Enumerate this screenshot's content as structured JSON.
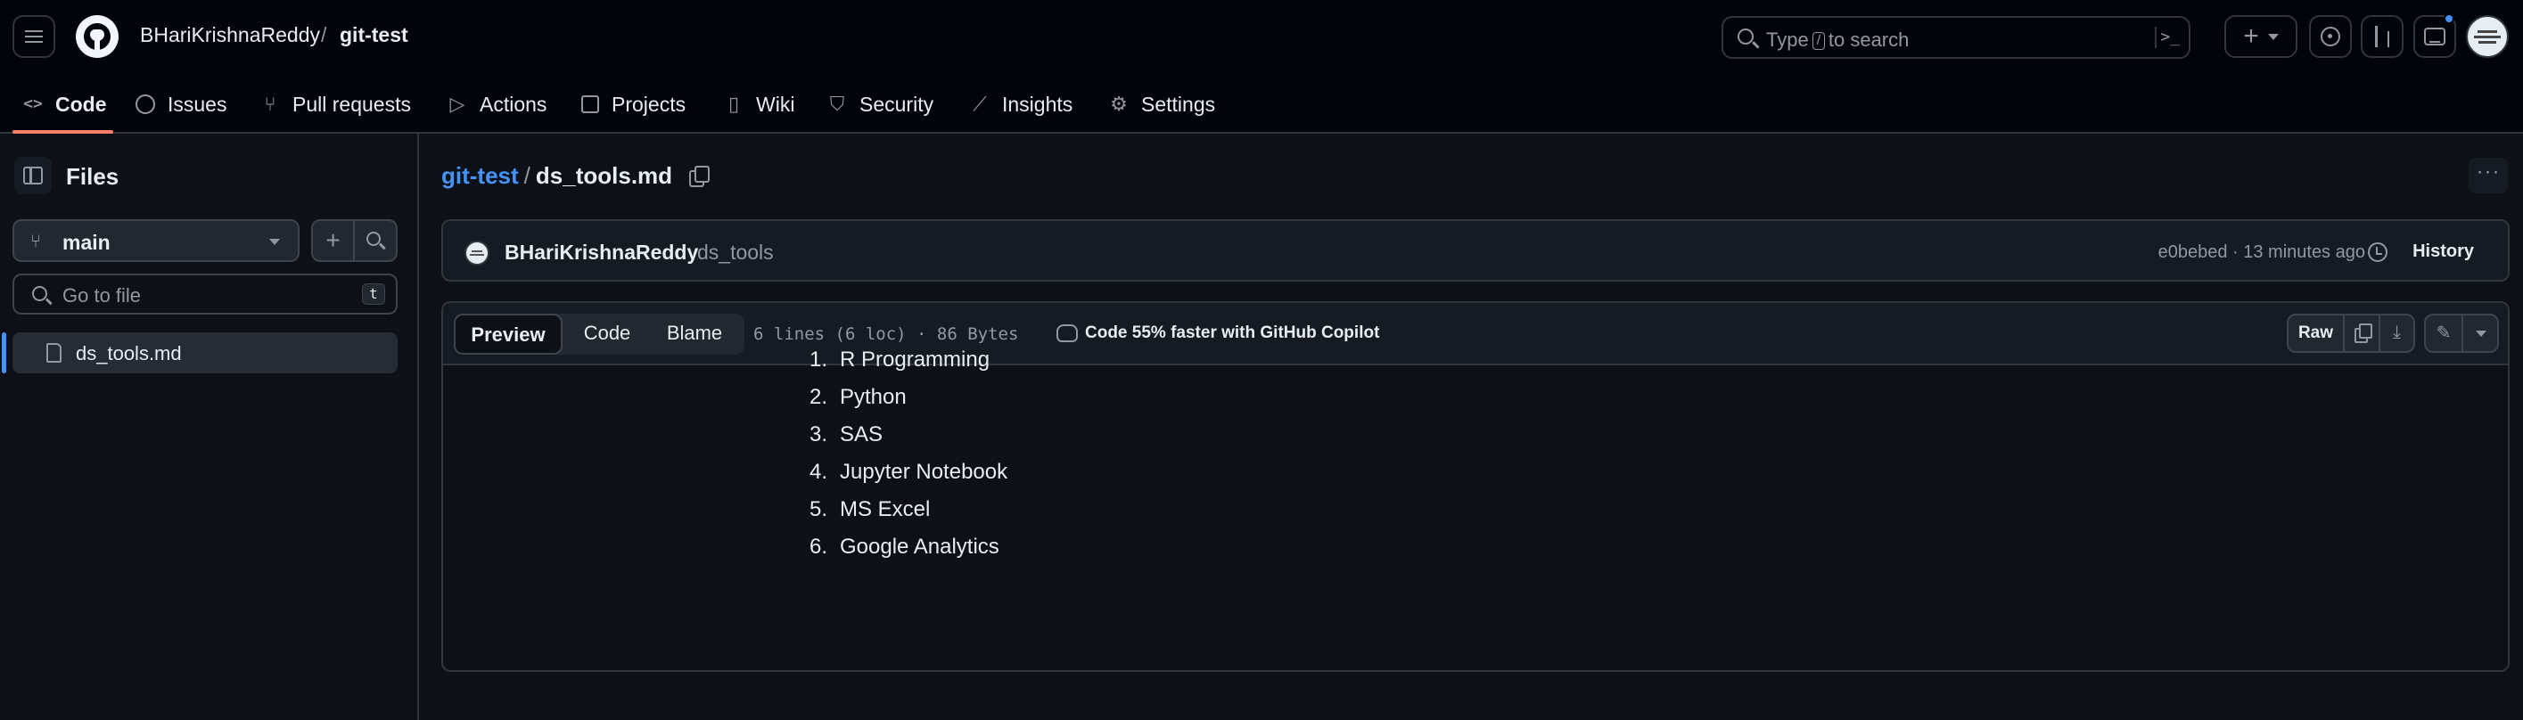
{
  "header": {
    "owner": "BHariKrishnaReddy",
    "separator": "/",
    "repo": "git-test",
    "search": {
      "prefix": "Type",
      "key": "/",
      "suffix": "to search",
      "command_icon": ">_"
    },
    "icons": [
      "hamburger-icon",
      "github-logo-icon",
      "plus-icon",
      "issues-icon",
      "pull-requests-icon",
      "inbox-icon"
    ]
  },
  "repo_nav": {
    "items": [
      {
        "label": "Code",
        "icon": "code-icon",
        "active": true
      },
      {
        "label": "Issues",
        "icon": "issue-icon"
      },
      {
        "label": "Pull requests",
        "icon": "pull-request-icon"
      },
      {
        "label": "Actions",
        "icon": "play-icon"
      },
      {
        "label": "Projects",
        "icon": "table-icon"
      },
      {
        "label": "Wiki",
        "icon": "book-icon"
      },
      {
        "label": "Security",
        "icon": "shield-icon"
      },
      {
        "label": "Insights",
        "icon": "graph-icon"
      },
      {
        "label": "Settings",
        "icon": "gear-icon"
      }
    ]
  },
  "sidebar": {
    "title": "Files",
    "branch": "main",
    "goto_placeholder": "Go to file",
    "goto_key": "t",
    "files": [
      {
        "name": "ds_tools.md",
        "selected": true
      }
    ]
  },
  "main": {
    "path": {
      "repo": "git-test",
      "separator": "/",
      "file": "ds_tools.md"
    },
    "commit": {
      "author": "BHariKrishnaReddy",
      "message": "ds_tools",
      "meta": "e0bebed · 13 minutes ago",
      "history_label": "History"
    },
    "toolbar": {
      "tabs": [
        "Preview",
        "Code",
        "Blame"
      ],
      "selected_tab": "Preview",
      "file_info": "6 lines (6 loc) · 86 Bytes",
      "copilot_text": "Code 55% faster with GitHub Copilot",
      "raw_label": "Raw"
    },
    "content": {
      "items": [
        {
          "num": "1.",
          "text": "R Programming"
        },
        {
          "num": "2.",
          "text": "Python"
        },
        {
          "num": "3.",
          "text": "SAS"
        },
        {
          "num": "4.",
          "text": "Jupyter Notebook"
        },
        {
          "num": "5.",
          "text": "MS Excel"
        },
        {
          "num": "6.",
          "text": "Google Analytics"
        }
      ]
    }
  },
  "colors": {
    "accent": "#4493f8",
    "nav_underline": "#f78166",
    "background": "#0d1117",
    "header_bg": "#010409"
  }
}
